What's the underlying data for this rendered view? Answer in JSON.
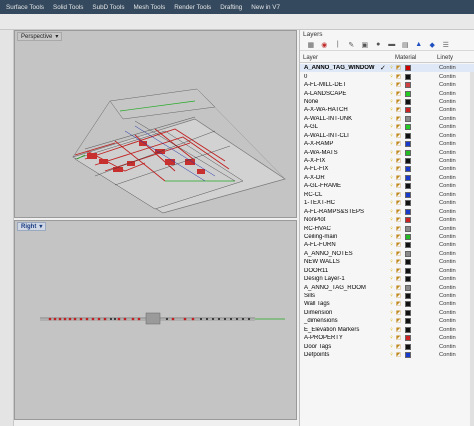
{
  "menu": [
    "Surface Tools",
    "Solid Tools",
    "SubD Tools",
    "Mesh Tools",
    "Render Tools",
    "Drafting",
    "New in V7"
  ],
  "viewports": {
    "top_label": "Perspective",
    "bottom_label": "Right"
  },
  "layers_panel": {
    "title": "Layers",
    "columns": {
      "layer": "Layer",
      "material": "Material",
      "linetype": "Linety"
    },
    "layers": [
      {
        "name": "A_ANNO_TAG_WINDOW",
        "color": "#d00000",
        "current": true,
        "linetype": "Contin"
      },
      {
        "name": "0",
        "color": "#111111",
        "linetype": "Contin"
      },
      {
        "name": "A-FL-MILL-DET",
        "color": "#d04040",
        "linetype": "Contin"
      },
      {
        "name": "A-LANDSCAPE",
        "color": "#22cc22",
        "linetype": "Contin"
      },
      {
        "name": "None",
        "color": "#111111",
        "linetype": "Contin"
      },
      {
        "name": "A-X-WA-HATCH",
        "color": "#cc2222",
        "linetype": "Contin"
      },
      {
        "name": "A-WALL-INT-UNK",
        "color": "#8a8a8a",
        "linetype": "Contin"
      },
      {
        "name": "A-GL",
        "color": "#22cc22",
        "linetype": "Contin"
      },
      {
        "name": "A-WALL-INT-CLI",
        "color": "#111111",
        "linetype": "Contin"
      },
      {
        "name": "A-X-RAMP",
        "color": "#1a3acc",
        "linetype": "Contin"
      },
      {
        "name": "A-WA-MATS",
        "color": "#22bb22",
        "linetype": "Contin"
      },
      {
        "name": "A-X-FIX",
        "color": "#111111",
        "linetype": "Contin"
      },
      {
        "name": "A-FL-FIX",
        "color": "#1a3acc",
        "linetype": "Contin"
      },
      {
        "name": "A-X-DR",
        "color": "#1a3acc",
        "linetype": "Contin"
      },
      {
        "name": "A-GL-FRAME",
        "color": "#111111",
        "linetype": "Contin"
      },
      {
        "name": "RC-CL",
        "color": "#1a3acc",
        "linetype": "Contin"
      },
      {
        "name": "1-TEXT-HC",
        "color": "#111111",
        "linetype": "Contin"
      },
      {
        "name": "A-FL-RAMPS&STEPS",
        "color": "#1a3acc",
        "linetype": "Contin"
      },
      {
        "name": "NonPlot",
        "color": "#cc2222",
        "linetype": "Contin"
      },
      {
        "name": "RC-HVAC",
        "color": "#8a8a8a",
        "linetype": "Contin"
      },
      {
        "name": "Ceiling-main",
        "color": "#22bb22",
        "linetype": "Contin"
      },
      {
        "name": "A-FL-FURN",
        "color": "#111111",
        "linetype": "Contin"
      },
      {
        "name": "A_ANNO_NOTES",
        "color": "#8a8a8a",
        "linetype": "Contin"
      },
      {
        "name": "NEW WALLS",
        "color": "#111111",
        "linetype": "Contin"
      },
      {
        "name": "DOOR11",
        "color": "#111111",
        "linetype": "Contin"
      },
      {
        "name": "Design Layer-1",
        "color": "#111111",
        "linetype": "Contin"
      },
      {
        "name": "A_ANNO_TAG_ROOM",
        "color": "#8a8a8a",
        "linetype": "Contin"
      },
      {
        "name": "Sills",
        "color": "#111111",
        "linetype": "Contin"
      },
      {
        "name": "Wall Tags",
        "color": "#111111",
        "linetype": "Contin"
      },
      {
        "name": "Dimension",
        "color": "#111111",
        "linetype": "Contin"
      },
      {
        "name": "_dimensions",
        "color": "#111111",
        "linetype": "Contin"
      },
      {
        "name": "E_Elevation Markers",
        "color": "#111111",
        "linetype": "Contin"
      },
      {
        "name": "A-PROPERTY",
        "color": "#cc2222",
        "linetype": "Contin"
      },
      {
        "name": "Door Tags",
        "color": "#111111",
        "linetype": "Contin"
      },
      {
        "name": "Defpoints",
        "color": "#1a3acc",
        "linetype": "Contin"
      }
    ]
  }
}
